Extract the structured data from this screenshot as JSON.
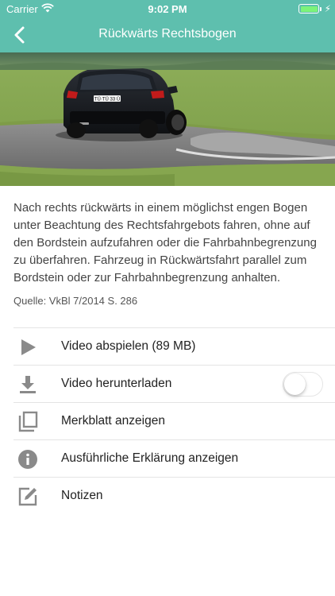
{
  "status_bar": {
    "carrier": "Carrier",
    "time": "9:02 PM"
  },
  "nav": {
    "title": "Rückwärts Rechtsbogen",
    "back_icon": "chevron-left-icon"
  },
  "hero": {
    "plate": "TÜ·TÜ 33 Ü"
  },
  "description": "Nach rechts rückwärts in einem möglichst engen Bogen unter Beachtung des Rechtsfahrgebots fahren, ohne auf den Bordstein aufzufahren oder die Fahrbahnbegrenzung zu überfahren. Fahrzeug in Rückwärtsfahrt parallel zum Bordstein oder zur Fahrbahnbegrenzung anhalten.",
  "source": "Quelle: VkBl 7/2014 S. 286",
  "actions": [
    {
      "label": "Video abspielen (89 MB)",
      "icon": "play-icon"
    },
    {
      "label": "Video herunterladen",
      "icon": "download-icon",
      "toggle_on": false
    },
    {
      "label": "Merkblatt anzeigen",
      "icon": "copy-icon"
    },
    {
      "label": "Ausführliche Erklärung anzeigen",
      "icon": "info-icon"
    },
    {
      "label": "Notizen",
      "icon": "edit-icon"
    }
  ],
  "colors": {
    "accent": "#5ebfae",
    "battery": "#7cf37a",
    "icon": "#8a8a8a"
  }
}
